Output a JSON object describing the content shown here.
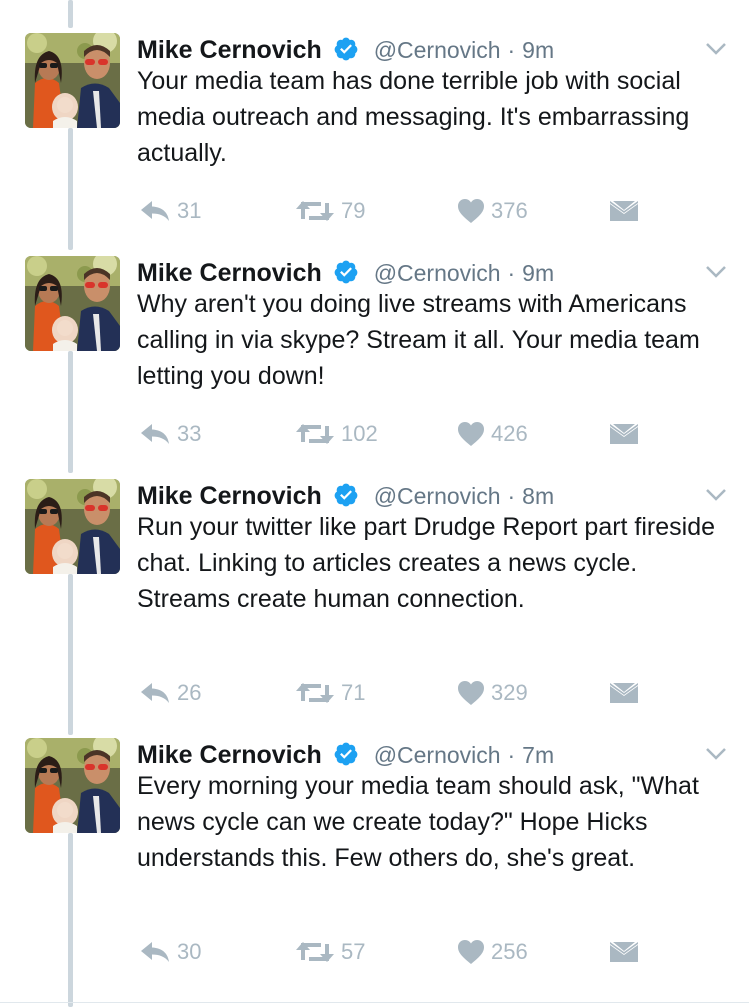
{
  "colors": {
    "verified": "#1da1f2",
    "secondary_text": "#657786",
    "action_icon": "#aab8c2",
    "thread_line": "#ccd6dd"
  },
  "tweets": [
    {
      "name": "Mike Cernovich",
      "handle": "@Cernovich",
      "dot": "·",
      "time": "9m",
      "text": "Your media team has done terrible job with social media outreach and messaging. It's embarrassing actually.",
      "replies": "31",
      "retweets": "79",
      "likes": "376"
    },
    {
      "name": "Mike Cernovich",
      "handle": "@Cernovich",
      "dot": "·",
      "time": "9m",
      "text": "Why aren't you doing live streams with Americans calling in via skype? Stream it all. Your media team letting you down!",
      "replies": "33",
      "retweets": "102",
      "likes": "426"
    },
    {
      "name": "Mike Cernovich",
      "handle": "@Cernovich",
      "dot": "·",
      "time": "8m",
      "text": "Run your twitter like part Drudge Report part fireside chat. Linking to articles creates a news cycle. Streams create human connection.",
      "replies": "26",
      "retweets": "71",
      "likes": "329"
    },
    {
      "name": "Mike Cernovich",
      "handle": "@Cernovich",
      "dot": "·",
      "time": "7m",
      "text": "Every morning your media team should ask, \"What news cycle can we create today?\" Hope Hicks understands this. Few others do, she's great.",
      "replies": "30",
      "retweets": "57",
      "likes": "256"
    }
  ]
}
